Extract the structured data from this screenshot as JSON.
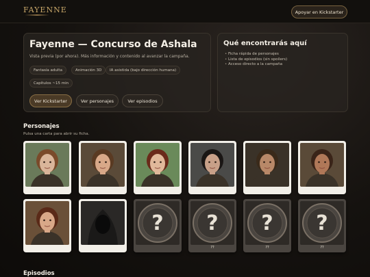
{
  "header": {
    "logo": "FAYENNE",
    "kickstarter_button": "Apoyar en Kickstarter"
  },
  "hero": {
    "title": "Fayenne — Concurso de Ashala",
    "subtitle": "Vista previa (por ahora). Más información y contenido al avanzar la campaña.",
    "tags": [
      "Fantasía adulta",
      "Animación 3D",
      "IA asistida (bajo dirección humana)",
      "Capítulos ~15 min"
    ],
    "buttons": [
      "Ver Kickstarter",
      "Ver personajes",
      "Ver episodios"
    ]
  },
  "info": {
    "title": "Qué encontrarás aquí",
    "items": [
      "Ficha rápida de personajes",
      "Lista de episodios (sin spoilers)",
      "Acceso directo a la campaña"
    ]
  },
  "characters": {
    "title": "Personajes",
    "subtitle": "Pulsa una carta para abrir su ficha.",
    "locked_label": "??",
    "cards": [
      {
        "state": "revealed",
        "caption": "",
        "icon": "portrait-young-woman",
        "bg": "#6a7a5a",
        "skin": "#d9b59a",
        "hair": "#7a4a2a"
      },
      {
        "state": "revealed",
        "caption": "",
        "icon": "portrait-young-man",
        "bg": "#5a4a38",
        "skin": "#d8a888",
        "hair": "#5a3a22"
      },
      {
        "state": "revealed",
        "caption": "",
        "icon": "portrait-girl",
        "bg": "#6a8a5a",
        "skin": "#e0b89a",
        "hair": "#6a2a1a"
      },
      {
        "state": "revealed",
        "caption": "",
        "icon": "portrait-dark-haired-man",
        "bg": "#4a4a48",
        "skin": "#c8a088",
        "hair": "#1a1614"
      },
      {
        "state": "revealed",
        "caption": "",
        "icon": "portrait-rugged-man",
        "bg": "#3a3228",
        "skin": "#b88868",
        "hair": "#3a2a1a"
      },
      {
        "state": "revealed",
        "caption": "",
        "icon": "portrait-bald-warrior",
        "bg": "#5a4a38",
        "skin": "#b07858",
        "hair": "#3a2418"
      },
      {
        "state": "revealed",
        "caption": "",
        "icon": "portrait-woman-red-dress",
        "bg": "#6a5038",
        "skin": "#d8a888",
        "hair": "#5a2a18"
      },
      {
        "state": "revealed",
        "caption": "",
        "icon": "hooded-figure-icon",
        "bg": "#2a2826",
        "skin": "#0a0a0a",
        "hair": "#1a1918"
      },
      {
        "state": "locked",
        "caption": "",
        "icon": "question-mark-icon",
        "bg": "#3a3530",
        "skin": "",
        "hair": ""
      },
      {
        "state": "locked",
        "caption": "??",
        "icon": "question-mark-icon",
        "bg": "#3a3530",
        "skin": "",
        "hair": ""
      },
      {
        "state": "locked",
        "caption": "??",
        "icon": "question-mark-icon",
        "bg": "#3a3530",
        "skin": "",
        "hair": ""
      },
      {
        "state": "locked",
        "caption": "??",
        "icon": "question-mark-icon",
        "bg": "#3a3530",
        "skin": "",
        "hair": ""
      }
    ]
  },
  "episodes": {
    "title": "Episodios"
  }
}
